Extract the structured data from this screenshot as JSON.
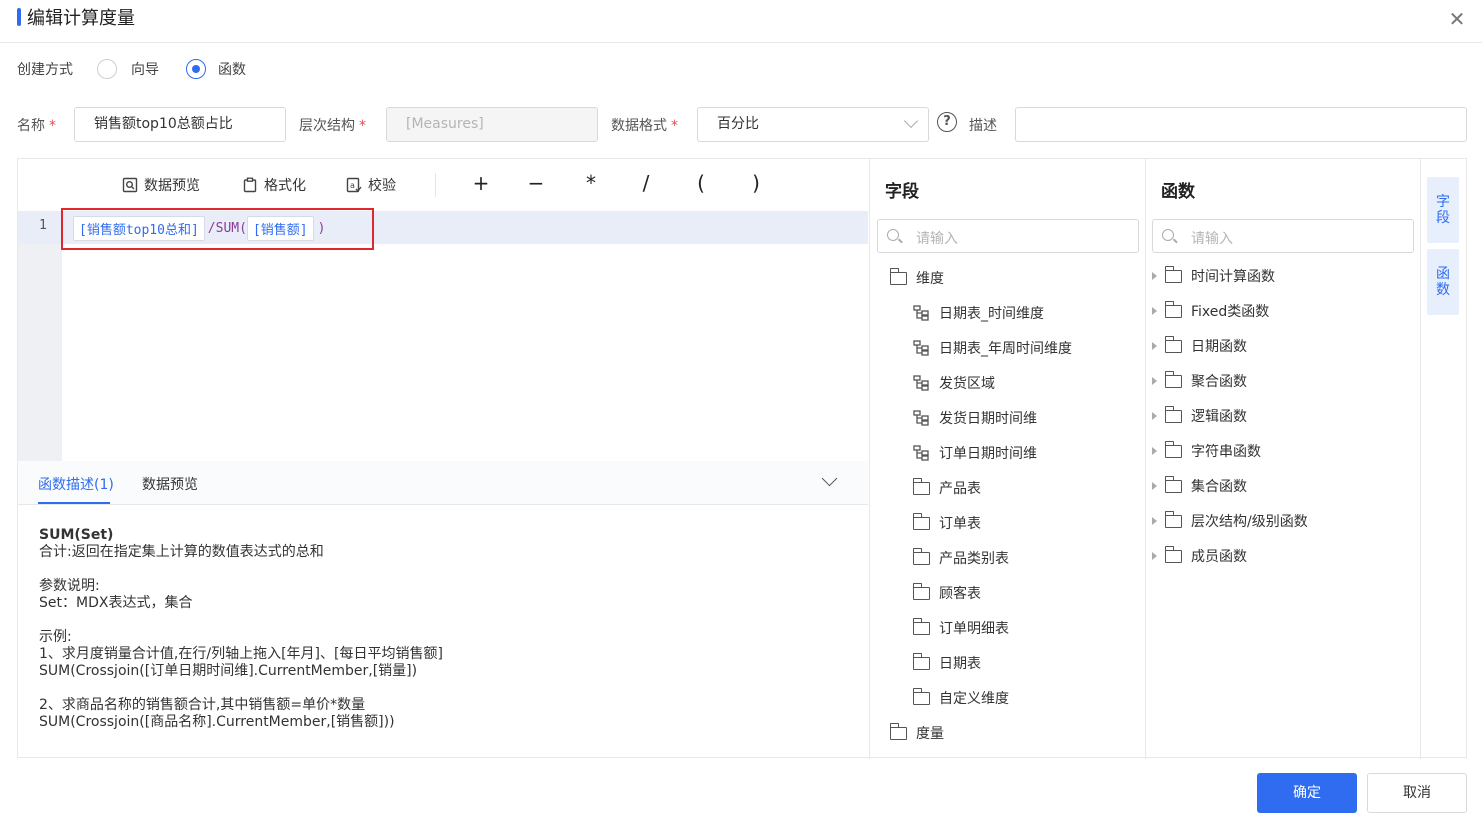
{
  "dialog": {
    "title": "编辑计算度量"
  },
  "create_mode": {
    "label": "创建方式",
    "options": [
      "向导",
      "函数"
    ],
    "selected": "函数"
  },
  "form": {
    "name_label": "名称",
    "name_value": "销售额top10总额占比",
    "hierarchy_label": "层次结构",
    "hierarchy_value": "[Measures]",
    "format_label": "数据格式",
    "format_value": "百分比",
    "help_glyph": "?",
    "desc_label": "描述",
    "desc_value": "",
    "required_mark": "*"
  },
  "toolbar": {
    "preview": "数据预览",
    "format": "格式化",
    "check": "校验",
    "ops": [
      "+",
      "−",
      "*",
      "/",
      "(",
      ")"
    ]
  },
  "editor": {
    "line_number": "1",
    "token1": "[销售额top10总和]",
    "slash": "/",
    "fn": "SUM(",
    "token2": "[销售额]",
    "close": ")"
  },
  "description": {
    "tabs": [
      "函数描述(1)",
      "数据预览"
    ],
    "active_tab": "函数描述(1)",
    "lines": {
      "fn_name": "SUM(Set)",
      "summary": "合计:返回在指定集上计算的数值表达式的总和",
      "params_title": "参数说明:",
      "params": "Set：MDX表达式，集合",
      "example_title": "示例:",
      "ex1": "1、求月度销量合计值,在行/列轴上拖入[年月]、[每日平均销售额]",
      "ex1_code": "SUM(Crossjoin([订单日期时间维].CurrentMember,[销量])",
      "ex2": "2、求商品名称的销售额合计,其中销售额=单价*数量",
      "ex2_code": "SUM(Crossjoin([商品名称].CurrentMember,[销售额]))"
    }
  },
  "fields_panel": {
    "title": "字段",
    "placeholder": "请输入",
    "root": "维度",
    "hierarchies": [
      "日期表_时间维度",
      "日期表_年周时间维度",
      "发货区域",
      "发货日期时间维",
      "订单日期时间维"
    ],
    "tables": [
      "产品表",
      "订单表",
      "产品类别表",
      "顾客表",
      "订单明细表",
      "日期表",
      "自定义维度"
    ],
    "partial": "度量"
  },
  "functions_panel": {
    "title": "函数",
    "placeholder": "请输入",
    "groups": [
      "时间计算函数",
      "Fixed类函数",
      "日期函数",
      "聚合函数",
      "逻辑函数",
      "字符串函数",
      "集合函数",
      "层次结构/级别函数",
      "成员函数"
    ]
  },
  "side_tabs": [
    "字段",
    "函数"
  ],
  "buttons": {
    "ok": "确定",
    "cancel": "取消"
  },
  "colors": {
    "accent": "#2f6cf0",
    "highlight_box": "#e0262e"
  }
}
